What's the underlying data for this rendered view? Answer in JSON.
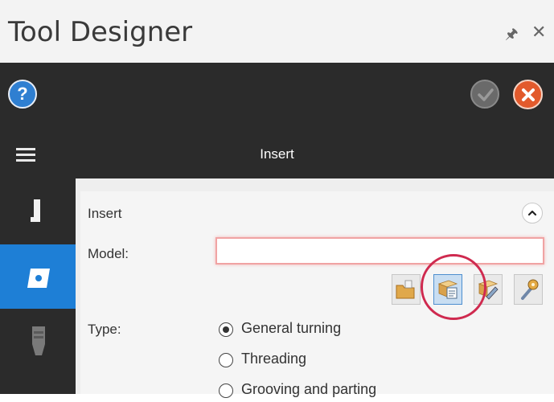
{
  "window": {
    "title": "Tool Designer",
    "pin_icon": "pin-icon",
    "close_icon": "close-icon"
  },
  "toolbar": {
    "help_label": "?",
    "accept_icon": "check-icon",
    "cancel_icon": "x-icon",
    "colors": {
      "help": "#2f7fd1",
      "cancel": "#e25a2c",
      "accept": "#6a6a6a"
    }
  },
  "header": {
    "menu_icon": "hamburger-icon",
    "title": "Insert"
  },
  "sidebar": {
    "items": [
      {
        "icon": "holder-icon",
        "selected": false
      },
      {
        "icon": "insert-icon",
        "selected": true
      },
      {
        "icon": "assembly-icon",
        "selected": false
      }
    ],
    "accent": "#1e7fd6"
  },
  "section": {
    "title": "Insert",
    "collapse_icon": "chevron-up-icon",
    "model_label": "Model:",
    "model_value": "",
    "model_buttons": [
      "open-folder-icon",
      "browse-library-icon",
      "edit-icon",
      "settings-icon"
    ],
    "type_label": "Type:",
    "type_options": [
      {
        "label": "General turning",
        "checked": true
      },
      {
        "label": "Threading",
        "checked": false
      },
      {
        "label": "Grooving and parting",
        "checked": false
      }
    ]
  }
}
